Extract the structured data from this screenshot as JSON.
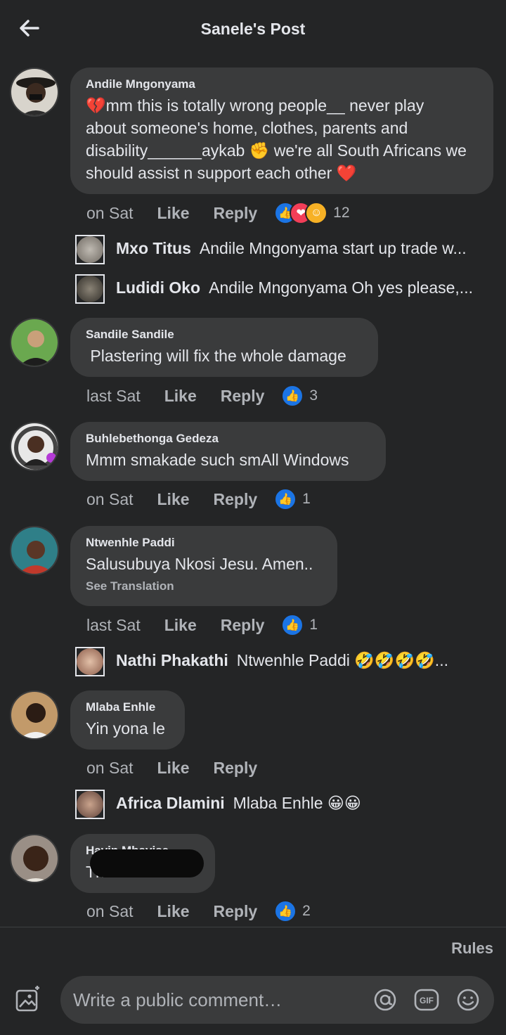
{
  "header": {
    "title": "Sanele's Post"
  },
  "comments": [
    {
      "author": "Andile Mngonyama",
      "text_lines": [
        "💔mm this is totally wrong people__ never play",
        "about someone's home, clothes, parents and",
        "disability______aykab ✊ we're all South Africans we",
        "should assist n support each other ❤️"
      ],
      "time": "on Sat",
      "like": "Like",
      "reply": "Reply",
      "reaction_count": "12",
      "replies": [
        {
          "name": "Mxo Titus",
          "text": "Andile Mngonyama start up trade w..."
        },
        {
          "name": "Ludidi Oko",
          "text": "Andile Mngonyama Oh yes please,..."
        }
      ]
    },
    {
      "author": "Sandile Sandile",
      "text": " Plastering will fix the whole damage",
      "time": "last Sat",
      "like": "Like",
      "reply": "Reply",
      "reaction_count": "3"
    },
    {
      "author": "Buhlebethonga Gedeza",
      "text": "Mmm smakade such smAll Windows",
      "time": "on Sat",
      "like": "Like",
      "reply": "Reply",
      "reaction_count": "1"
    },
    {
      "author": "Ntwenhle Paddi",
      "text": "Salusubuya Nkosi Jesu. Amen..",
      "see_translation": "See Translation",
      "time": "last Sat",
      "like": "Like",
      "reply": "Reply",
      "reaction_count": "1",
      "replies": [
        {
          "name": "Nathi Phakathi",
          "text": "Ntwenhle Paddi 🤣🤣🤣🤣..."
        }
      ]
    },
    {
      "author": "Mlaba Enhle",
      "text": "Yin yona le",
      "time": "on Sat",
      "like": "Like",
      "reply": "Reply",
      "replies": [
        {
          "name": "Africa Dlamini",
          "text": "Mlaba Enhle 😀😀"
        }
      ]
    },
    {
      "author": "Havin Mbavise",
      "text": "This is ba",
      "time": "on Sat",
      "like": "Like",
      "reply": "Reply",
      "reaction_count": "2"
    }
  ],
  "footer": {
    "rules": "Rules",
    "composer_placeholder": "Write a public comment…",
    "gif_label": "GIF"
  },
  "colors": {
    "background": "#242526",
    "bubble": "#3a3b3c",
    "like_blue": "#1b74e4",
    "love_red": "#f33e58",
    "haha_yellow": "#f7b125"
  }
}
